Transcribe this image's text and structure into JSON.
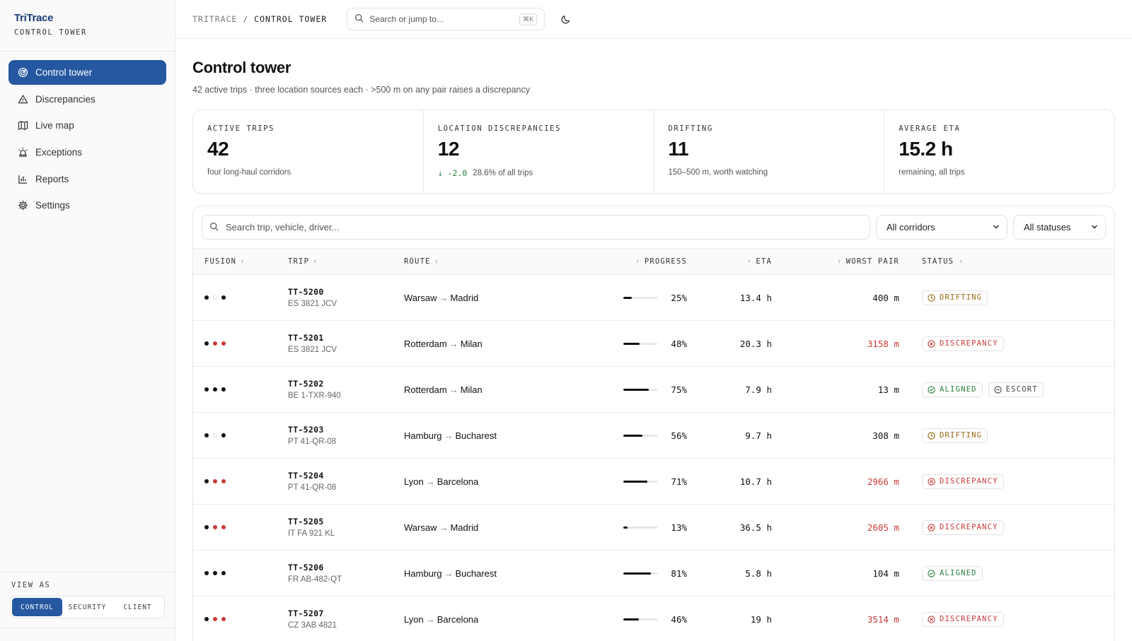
{
  "app": {
    "name": "TriTrace",
    "subtitle": "CONTROL TOWER"
  },
  "sidebar": {
    "items": [
      {
        "label": "Control tower",
        "icon": "radar-icon",
        "active": true
      },
      {
        "label": "Discrepancies",
        "icon": "warning-icon",
        "active": false
      },
      {
        "label": "Live map",
        "icon": "map-icon",
        "active": false
      },
      {
        "label": "Exceptions",
        "icon": "siren-icon",
        "active": false
      },
      {
        "label": "Reports",
        "icon": "bar-chart-icon",
        "active": false
      },
      {
        "label": "Settings",
        "icon": "gear-icon",
        "active": false
      }
    ],
    "view_as": {
      "label": "VIEW AS",
      "options": [
        "CONTROL",
        "SECURITY",
        "CLIENT"
      ],
      "selected": "CONTROL"
    }
  },
  "topbar": {
    "breadcrumb_root": "TRITRACE",
    "breadcrumb_sep": " / ",
    "breadcrumb_current": "CONTROL TOWER",
    "search_placeholder": "Search or jump to...",
    "shortcut": "⌘K"
  },
  "page": {
    "title": "Control tower",
    "subtitle": "42 active trips · three location sources each · >500 m on any pair raises a discrepancy"
  },
  "stats": [
    {
      "label": "ACTIVE TRIPS",
      "value": "42",
      "note": "four long-haul corridors"
    },
    {
      "label": "LOCATION DISCREPANCIES",
      "value": "12",
      "delta": "↓ -2.0",
      "note": "28.6% of all trips"
    },
    {
      "label": "DRIFTING",
      "value": "11",
      "note": "150–500 m, worth watching"
    },
    {
      "label": "AVERAGE ETA",
      "value": "15.2 h",
      "note": "remaining, all trips"
    }
  ],
  "filters": {
    "search_placeholder": "Search trip, vehicle, driver...",
    "corridor": "All corridors",
    "status": "All statuses"
  },
  "columns": {
    "fusion": "FUSION",
    "trip": "TRIP",
    "route": "ROUTE",
    "progress": "PROGRESS",
    "eta": "ETA",
    "worst": "WORST PAIR",
    "status": "STATUS"
  },
  "colors": {
    "accent": "#2558a0",
    "alert": "#c93a3a",
    "ok": "#2a7d3a",
    "warn": "#9a6a12"
  },
  "rows": [
    {
      "fusion": [
        "dark",
        "hollow",
        "dark"
      ],
      "trip": "TT-5200",
      "vehicle": "ES 3821 JCV",
      "from": "Warsaw",
      "to": "Madrid",
      "progress": 25,
      "progress_label": "25%",
      "eta": "13.4 h",
      "worst": "400 m",
      "worst_alert": false,
      "status": "DRIFTING",
      "status_kind": "drifting"
    },
    {
      "fusion": [
        "dark",
        "red",
        "red"
      ],
      "trip": "TT-5201",
      "vehicle": "ES 3821 JCV",
      "from": "Rotterdam",
      "to": "Milan",
      "progress": 48,
      "progress_label": "48%",
      "eta": "20.3 h",
      "worst": "3158 m",
      "worst_alert": true,
      "status": "DISCREPANCY",
      "status_kind": "discrepancy"
    },
    {
      "fusion": [
        "dark",
        "dark",
        "dark"
      ],
      "trip": "TT-5202",
      "vehicle": "BE 1-TXR-940",
      "from": "Rotterdam",
      "to": "Milan",
      "progress": 75,
      "progress_label": "75%",
      "eta": "7.9 h",
      "worst": "13 m",
      "worst_alert": false,
      "status": "ALIGNED",
      "status_kind": "aligned",
      "extra": "ESCORT"
    },
    {
      "fusion": [
        "dark",
        "hollow",
        "dark"
      ],
      "trip": "TT-5203",
      "vehicle": "PT 41-QR-08",
      "from": "Hamburg",
      "to": "Bucharest",
      "progress": 56,
      "progress_label": "56%",
      "eta": "9.7 h",
      "worst": "308 m",
      "worst_alert": false,
      "status": "DRIFTING",
      "status_kind": "drifting"
    },
    {
      "fusion": [
        "dark",
        "red",
        "red"
      ],
      "trip": "TT-5204",
      "vehicle": "PT 41-QR-08",
      "from": "Lyon",
      "to": "Barcelona",
      "progress": 71,
      "progress_label": "71%",
      "eta": "10.7 h",
      "worst": "2966 m",
      "worst_alert": true,
      "status": "DISCREPANCY",
      "status_kind": "discrepancy"
    },
    {
      "fusion": [
        "dark",
        "red",
        "red"
      ],
      "trip": "TT-5205",
      "vehicle": "IT FA 921 KL",
      "from": "Warsaw",
      "to": "Madrid",
      "progress": 13,
      "progress_label": "13%",
      "eta": "36.5 h",
      "worst": "2605 m",
      "worst_alert": true,
      "status": "DISCREPANCY",
      "status_kind": "discrepancy"
    },
    {
      "fusion": [
        "dark",
        "dark",
        "dark"
      ],
      "trip": "TT-5206",
      "vehicle": "FR AB-482-QT",
      "from": "Hamburg",
      "to": "Bucharest",
      "progress": 81,
      "progress_label": "81%",
      "eta": "5.8 h",
      "worst": "104 m",
      "worst_alert": false,
      "status": "ALIGNED",
      "status_kind": "aligned"
    },
    {
      "fusion": [
        "dark",
        "red",
        "red"
      ],
      "trip": "TT-5207",
      "vehicle": "CZ 3AB 4821",
      "from": "Lyon",
      "to": "Barcelona",
      "progress": 46,
      "progress_label": "46%",
      "eta": "19 h",
      "worst": "3514 m",
      "worst_alert": true,
      "status": "DISCREPANCY",
      "status_kind": "discrepancy"
    }
  ]
}
